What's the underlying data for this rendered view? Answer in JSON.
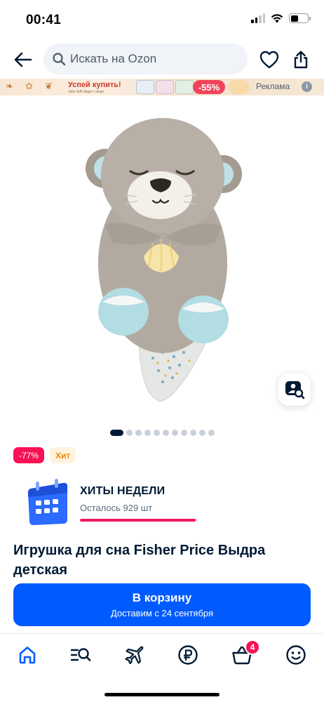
{
  "status_bar": {
    "time": "00:41",
    "battery_fraction": 0.45
  },
  "header": {
    "search_placeholder": "Искать на Ozon",
    "icons": {
      "back": "arrow-left-icon",
      "search": "search-icon",
      "favorite": "heart-icon",
      "share": "share-icon"
    }
  },
  "ad": {
    "headline": "Успей купить!",
    "subline": "Jolie Soft diaper Lange",
    "discount": "-55%",
    "label": "Реклама",
    "info_icon": "i"
  },
  "gallery": {
    "total_images": 11,
    "active_index": 0,
    "visual_search_icon": "visual-search-icon"
  },
  "badges": {
    "discount": "-77%",
    "hit": "Хит"
  },
  "hits_week": {
    "title": "ХИТЫ НЕДЕЛИ",
    "remaining": "Осталось 929 шт",
    "progress_fraction": 0.98,
    "icon": "calendar-icon"
  },
  "product": {
    "title": "Игрушка для сна Fisher Price Выдра детская"
  },
  "cart": {
    "label": "В корзину",
    "delivery": "Доставим с 24 сентября"
  },
  "bottom_nav": {
    "items": [
      {
        "id": "home",
        "icon": "home-icon",
        "active": true
      },
      {
        "id": "catalog",
        "icon": "catalog-search-icon",
        "active": false
      },
      {
        "id": "travel",
        "icon": "airplane-icon",
        "active": false
      },
      {
        "id": "finance",
        "icon": "ruble-icon",
        "active": false
      },
      {
        "id": "cart",
        "icon": "basket-icon",
        "active": false,
        "badge": "4"
      },
      {
        "id": "profile",
        "icon": "smiley-icon",
        "active": false
      }
    ]
  },
  "colors": {
    "brand_blue": "#005bff",
    "discount_pink": "#f91155",
    "text_dark": "#001a34",
    "hit_orange": "#f08a00"
  }
}
